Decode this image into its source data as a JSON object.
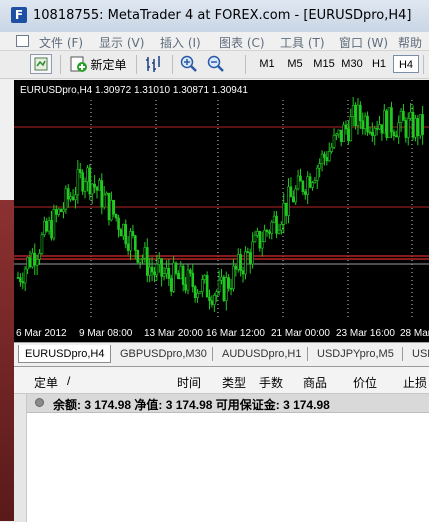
{
  "window": {
    "title": "10818755: MetaTrader 4 at FOREX.com - [EURUSDpro,H4]",
    "logo_letter": "F"
  },
  "menu": [
    {
      "label": "文件 (F)"
    },
    {
      "label": "显示 (V)"
    },
    {
      "label": "插入 (I)"
    },
    {
      "label": "图表 (C)"
    },
    {
      "label": "工具 (T)"
    },
    {
      "label": "窗口 (W)"
    },
    {
      "label": "帮助"
    }
  ],
  "toolbar": {
    "new_order_label": "新定单",
    "timeframes": [
      "M1",
      "M5",
      "M15",
      "M30",
      "H1",
      "H4"
    ],
    "active_timeframe": "H4"
  },
  "chart": {
    "header": "EURUSDpro,H4  1.30972 1.31010 1.30871 1.30941",
    "x_labels": [
      "6 Mar 2012",
      "9 Mar 08:00",
      "13 Mar 20:00",
      "16 Mar 12:00",
      "21 Mar 00:00",
      "23 Mar 16:00",
      "28 Mar"
    ],
    "colors": {
      "background": "#000000",
      "candle": "#22c922",
      "hline": "#b52525",
      "vgrid": "#c8c8c8"
    }
  },
  "chart_data": {
    "type": "line",
    "title": "EURUSDpro,H4",
    "x": [
      "6 Mar 2012",
      "9 Mar 08:00",
      "13 Mar 20:00",
      "16 Mar 12:00",
      "21 Mar 00:00",
      "23 Mar 16:00",
      "28 Mar"
    ],
    "series": [
      {
        "name": "EURUSDpro,H4",
        "values": [
          1.3102,
          1.3255,
          1.311,
          1.308,
          1.321,
          1.3335,
          1.3318
        ]
      }
    ],
    "quote": {
      "open": 1.30972,
      "high": 1.3101,
      "low": 1.30871,
      "close": 1.30941
    }
  },
  "chart_tabs": [
    "EURUSDpro,H4",
    "GBPUSDpro,M30",
    "AUDUSDpro,H1",
    "USDJPYpro,M5",
    "USD"
  ],
  "terminal": {
    "columns": [
      "定单",
      "/",
      "时间",
      "类型",
      "手数",
      "商品",
      "价位",
      "止损"
    ],
    "balance_text": "余额: 3 174.98  净值: 3 174.98  可用保证金: 3 174.98"
  }
}
